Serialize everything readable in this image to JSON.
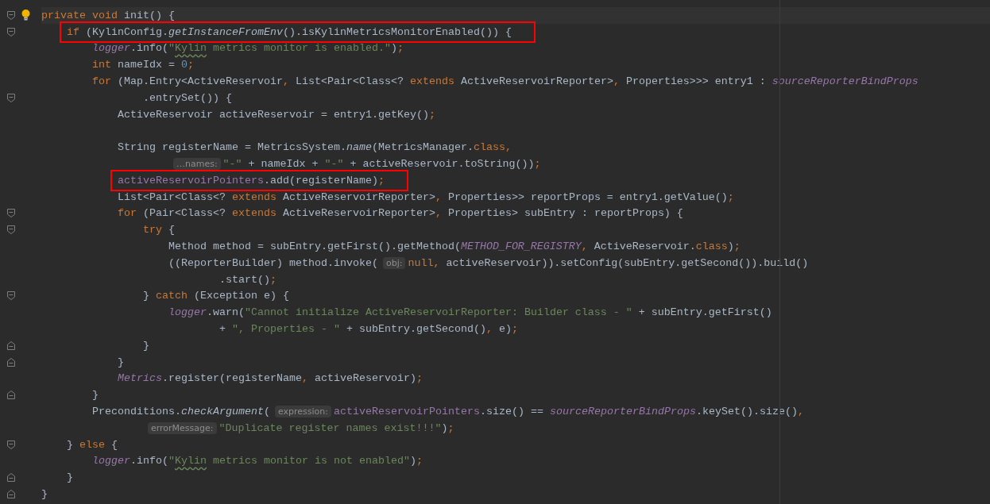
{
  "editor": {
    "lines": [
      {
        "current": true,
        "fold_start": true,
        "fold_end": false,
        "bulb": true,
        "boxed": false,
        "tokens": [
          {
            "kind": "keyword",
            "text": "private void"
          },
          {
            "kind": "plain",
            "text": " init() {"
          }
        ]
      },
      {
        "current": false,
        "fold_start": true,
        "fold_end": false,
        "bulb": false,
        "boxed": true,
        "tokens": [
          {
            "kind": "keyword",
            "text": "    if"
          },
          {
            "kind": "plain",
            "text": " (KylinConfig."
          },
          {
            "kind": "static",
            "text": "getInstanceFromEnv"
          },
          {
            "kind": "plain",
            "text": "().isKylinMetricsMonitorEnabled()) {"
          }
        ]
      },
      {
        "current": false,
        "fold_start": false,
        "fold_end": false,
        "bulb": false,
        "boxed": false,
        "tokens": [
          {
            "kind": "field-static",
            "text": "        logger"
          },
          {
            "kind": "plain",
            "text": ".info("
          },
          {
            "kind": "string",
            "text": "\""
          },
          {
            "kind": "string-typo",
            "text": "Kylin"
          },
          {
            "kind": "string",
            "text": " metrics monitor is enabled.\""
          },
          {
            "kind": "plain",
            "text": ")"
          },
          {
            "kind": "keyword",
            "text": ";"
          }
        ]
      },
      {
        "current": false,
        "fold_start": false,
        "fold_end": false,
        "bulb": false,
        "boxed": false,
        "tokens": [
          {
            "kind": "keyword",
            "text": "        int"
          },
          {
            "kind": "plain",
            "text": " nameIdx = "
          },
          {
            "kind": "number",
            "text": "0"
          },
          {
            "kind": "keyword",
            "text": ";"
          }
        ]
      },
      {
        "current": false,
        "fold_start": false,
        "fold_end": false,
        "bulb": false,
        "boxed": false,
        "tokens": [
          {
            "kind": "keyword",
            "text": "        for"
          },
          {
            "kind": "plain",
            "text": " (Map.Entry<ActiveReservoir"
          },
          {
            "kind": "keyword",
            "text": ","
          },
          {
            "kind": "plain",
            "text": " List<Pair<Class<? "
          },
          {
            "kind": "keyword",
            "text": "extends"
          },
          {
            "kind": "plain",
            "text": " ActiveReservoirReporter>"
          },
          {
            "kind": "keyword",
            "text": ","
          },
          {
            "kind": "plain",
            "text": " Properties>>> entry1 : "
          },
          {
            "kind": "field-static",
            "text": "sourceReporterBindProps"
          }
        ]
      },
      {
        "current": false,
        "fold_start": true,
        "fold_end": false,
        "bulb": false,
        "boxed": false,
        "tokens": [
          {
            "kind": "plain",
            "text": "                .entrySet()) {"
          }
        ]
      },
      {
        "current": false,
        "fold_start": false,
        "fold_end": false,
        "bulb": false,
        "boxed": false,
        "tokens": [
          {
            "kind": "plain",
            "text": "            ActiveReservoir activeReservoir = entry1.getKey()"
          },
          {
            "kind": "keyword",
            "text": ";"
          }
        ]
      },
      {
        "current": false,
        "fold_start": false,
        "fold_end": false,
        "bulb": false,
        "boxed": false
      },
      {
        "current": false,
        "fold_start": false,
        "fold_end": false,
        "bulb": false,
        "boxed": false,
        "tokens": [
          {
            "kind": "plain",
            "text": "            String registerName = MetricsSystem."
          },
          {
            "kind": "static",
            "text": "name"
          },
          {
            "kind": "plain",
            "text": "(MetricsManager."
          },
          {
            "kind": "keyword",
            "text": "class,"
          }
        ]
      },
      {
        "current": false,
        "fold_start": false,
        "fold_end": false,
        "bulb": false,
        "boxed": false,
        "tokens": [
          {
            "kind": "hint",
            "text": "                    …names:"
          },
          {
            "kind": "string",
            "text": "\"-\""
          },
          {
            "kind": "plain",
            "text": " + nameIdx + "
          },
          {
            "kind": "string",
            "text": "\"-\""
          },
          {
            "kind": "plain",
            "text": " + activeReservoir.toString())"
          },
          {
            "kind": "keyword",
            "text": ";"
          }
        ]
      },
      {
        "current": false,
        "fold_start": false,
        "fold_end": false,
        "bulb": false,
        "boxed": true,
        "tokens": [
          {
            "kind": "field",
            "text": "            activeReservoirPointers"
          },
          {
            "kind": "plain",
            "text": ".add(registerName)"
          },
          {
            "kind": "keyword",
            "text": ";"
          }
        ]
      },
      {
        "current": false,
        "fold_start": false,
        "fold_end": false,
        "bulb": false,
        "boxed": false,
        "tokens": [
          {
            "kind": "plain",
            "text": "            List<Pair<Class<? "
          },
          {
            "kind": "keyword",
            "text": "extends"
          },
          {
            "kind": "plain",
            "text": " ActiveReservoirReporter>"
          },
          {
            "kind": "keyword",
            "text": ","
          },
          {
            "kind": "plain",
            "text": " Properties>> reportProps = entry1.getValue()"
          },
          {
            "kind": "keyword",
            "text": ";"
          }
        ]
      },
      {
        "current": false,
        "fold_start": true,
        "fold_end": false,
        "bulb": false,
        "boxed": false,
        "tokens": [
          {
            "kind": "keyword",
            "text": "            for"
          },
          {
            "kind": "plain",
            "text": " (Pair<Class<? "
          },
          {
            "kind": "keyword",
            "text": "extends"
          },
          {
            "kind": "plain",
            "text": " ActiveReservoirReporter>"
          },
          {
            "kind": "keyword",
            "text": ","
          },
          {
            "kind": "plain",
            "text": " Properties> subEntry : reportProps) {"
          }
        ]
      },
      {
        "current": false,
        "fold_start": true,
        "fold_end": false,
        "bulb": false,
        "boxed": false,
        "tokens": [
          {
            "kind": "keyword",
            "text": "                try"
          },
          {
            "kind": "plain",
            "text": " {"
          }
        ]
      },
      {
        "current": false,
        "fold_start": false,
        "fold_end": false,
        "bulb": false,
        "boxed": false,
        "tokens": [
          {
            "kind": "plain",
            "text": "                    Method method = subEntry.getFirst().getMethod("
          },
          {
            "kind": "field-static",
            "text": "METHOD_FOR_REGISTRY"
          },
          {
            "kind": "keyword",
            "text": ","
          },
          {
            "kind": "plain",
            "text": " ActiveReservoir."
          },
          {
            "kind": "keyword",
            "text": "class"
          },
          {
            "kind": "plain",
            "text": ")"
          },
          {
            "kind": "keyword",
            "text": ";"
          }
        ]
      },
      {
        "current": false,
        "fold_start": false,
        "fold_end": false,
        "bulb": false,
        "boxed": false,
        "tokens": [
          {
            "kind": "plain",
            "text": "                    ((ReporterBuilder) method.invoke("
          },
          {
            "kind": "hint",
            "text": "obj:"
          },
          {
            "kind": "keyword",
            "text": "null,"
          },
          {
            "kind": "plain",
            "text": " activeReservoir)).setConfig(subEntry.getSecond()).build()"
          }
        ]
      },
      {
        "current": false,
        "fold_start": false,
        "fold_end": false,
        "bulb": false,
        "boxed": false,
        "tokens": [
          {
            "kind": "plain",
            "text": "                            .start()"
          },
          {
            "kind": "keyword",
            "text": ";"
          }
        ]
      },
      {
        "current": false,
        "fold_start": true,
        "fold_end": false,
        "bulb": false,
        "boxed": false,
        "tokens": [
          {
            "kind": "plain",
            "text": "                } "
          },
          {
            "kind": "keyword",
            "text": "catch"
          },
          {
            "kind": "plain",
            "text": " (Exception e) {"
          }
        ]
      },
      {
        "current": false,
        "fold_start": false,
        "fold_end": false,
        "bulb": false,
        "boxed": false,
        "tokens": [
          {
            "kind": "field-static",
            "text": "                    logger"
          },
          {
            "kind": "plain",
            "text": ".warn("
          },
          {
            "kind": "string",
            "text": "\"Cannot initialize ActiveReservoirReporter: Builder class - \""
          },
          {
            "kind": "plain",
            "text": " + subEntry.getFirst()"
          }
        ]
      },
      {
        "current": false,
        "fold_start": false,
        "fold_end": false,
        "bulb": false,
        "boxed": false,
        "tokens": [
          {
            "kind": "plain",
            "text": "                            + "
          },
          {
            "kind": "string",
            "text": "\", Properties - \""
          },
          {
            "kind": "plain",
            "text": " + subEntry.getSecond()"
          },
          {
            "kind": "keyword",
            "text": ","
          },
          {
            "kind": "plain",
            "text": " e)"
          },
          {
            "kind": "keyword",
            "text": ";"
          }
        ]
      },
      {
        "current": false,
        "fold_start": false,
        "fold_end": true,
        "bulb": false,
        "boxed": false,
        "tokens": [
          {
            "kind": "plain",
            "text": "                }"
          }
        ]
      },
      {
        "current": false,
        "fold_start": false,
        "fold_end": true,
        "bulb": false,
        "boxed": false,
        "tokens": [
          {
            "kind": "plain",
            "text": "            }"
          }
        ]
      },
      {
        "current": false,
        "fold_start": false,
        "fold_end": false,
        "bulb": false,
        "boxed": false,
        "tokens": [
          {
            "kind": "field-static",
            "text": "            Metrics"
          },
          {
            "kind": "plain",
            "text": ".register(registerName"
          },
          {
            "kind": "keyword",
            "text": ","
          },
          {
            "kind": "plain",
            "text": " activeReservoir)"
          },
          {
            "kind": "keyword",
            "text": ";"
          }
        ]
      },
      {
        "current": false,
        "fold_start": false,
        "fold_end": true,
        "bulb": false,
        "boxed": false,
        "tokens": [
          {
            "kind": "plain",
            "text": "        }"
          }
        ]
      },
      {
        "current": false,
        "fold_start": false,
        "fold_end": false,
        "bulb": false,
        "boxed": false,
        "tokens": [
          {
            "kind": "plain",
            "text": "        Preconditions."
          },
          {
            "kind": "static",
            "text": "checkArgument"
          },
          {
            "kind": "plain",
            "text": "("
          },
          {
            "kind": "hint",
            "text": "expression:"
          },
          {
            "kind": "field",
            "text": "activeReservoirPointers"
          },
          {
            "kind": "plain",
            "text": ".size() == "
          },
          {
            "kind": "field-static",
            "text": "sourceReporterBindProps"
          },
          {
            "kind": "plain",
            "text": ".keySet().size()"
          },
          {
            "kind": "keyword",
            "text": ","
          }
        ]
      },
      {
        "current": false,
        "fold_start": false,
        "fold_end": false,
        "bulb": false,
        "boxed": false,
        "tokens": [
          {
            "kind": "hint",
            "text": "                errorMessage:"
          },
          {
            "kind": "string",
            "text": "\"Duplicate register names exist!!!\""
          },
          {
            "kind": "plain",
            "text": ")"
          },
          {
            "kind": "keyword",
            "text": ";"
          }
        ]
      },
      {
        "current": false,
        "fold_start": true,
        "fold_end": false,
        "bulb": false,
        "boxed": false,
        "tokens": [
          {
            "kind": "plain",
            "text": "    } "
          },
          {
            "kind": "keyword",
            "text": "else"
          },
          {
            "kind": "plain",
            "text": " {"
          }
        ]
      },
      {
        "current": false,
        "fold_start": false,
        "fold_end": false,
        "bulb": false,
        "boxed": false,
        "tokens": [
          {
            "kind": "field-static",
            "text": "        logger"
          },
          {
            "kind": "plain",
            "text": ".info("
          },
          {
            "kind": "string",
            "text": "\""
          },
          {
            "kind": "string-typo",
            "text": "Kylin"
          },
          {
            "kind": "string",
            "text": " metrics monitor is not enabled\""
          },
          {
            "kind": "plain",
            "text": ")"
          },
          {
            "kind": "keyword",
            "text": ";"
          }
        ]
      },
      {
        "current": false,
        "fold_start": false,
        "fold_end": true,
        "bulb": false,
        "boxed": false,
        "tokens": [
          {
            "kind": "plain",
            "text": "    }"
          }
        ]
      },
      {
        "current": false,
        "fold_start": false,
        "fold_end": true,
        "bulb": false,
        "boxed": false,
        "tokens": [
          {
            "kind": "plain",
            "text": "}"
          }
        ]
      }
    ]
  }
}
